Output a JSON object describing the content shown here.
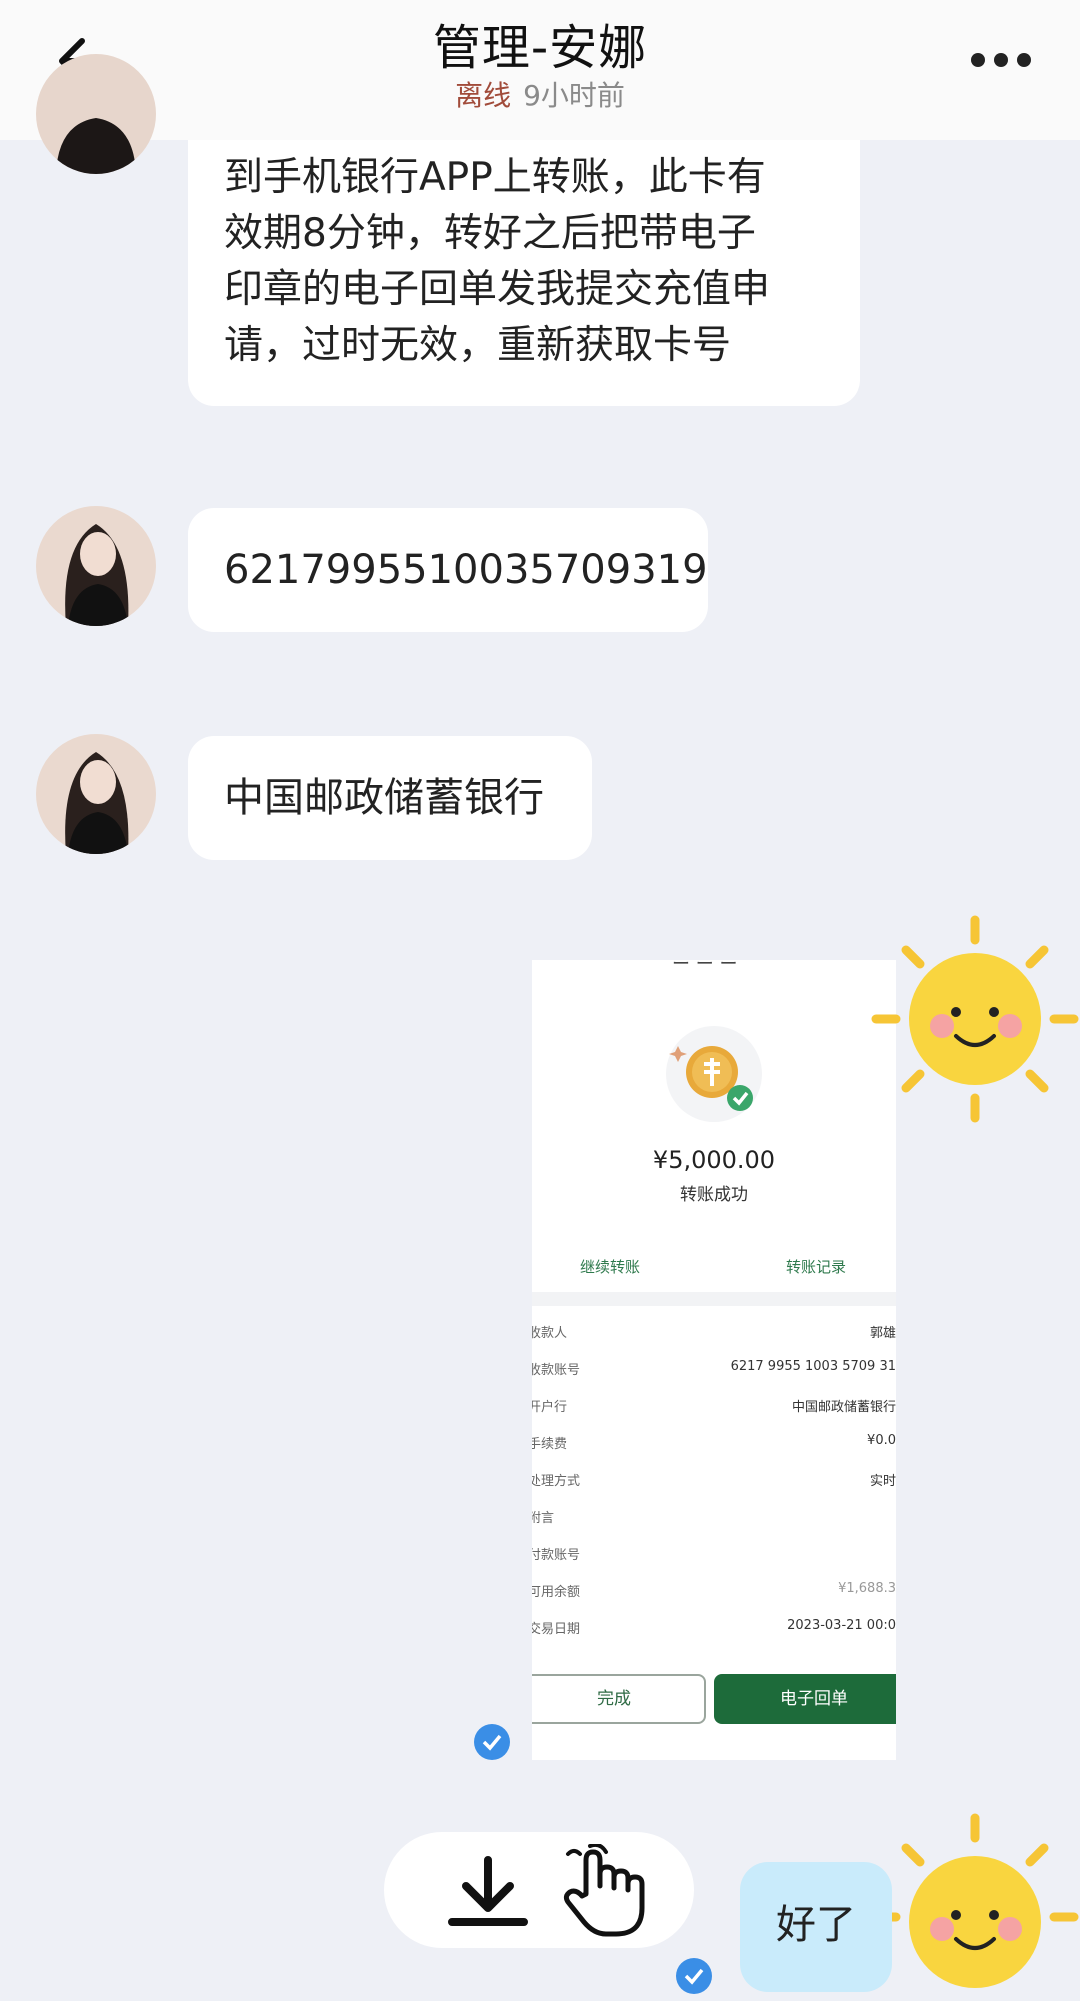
{
  "header": {
    "title": "管理-安娜",
    "status": "离线",
    "last_seen": "9小时前"
  },
  "messages": {
    "m1_lines": [
      "到手机银行APP上转账，此卡有",
      "效期8分钟，转好之后把带电子",
      "印章的电子回单发我提交充值申",
      "请，过时无效，重新获取卡号"
    ],
    "m2": "6217995510035709319",
    "m3": "中国邮政储蓄银行",
    "sent": "好了"
  },
  "receipt": {
    "amount": "¥5,000.00",
    "status": "转账成功",
    "continue_label": "继续转账",
    "records_label": "转账记录",
    "rows": [
      {
        "label": "收款人",
        "value": "郭雄"
      },
      {
        "label": "收款账号",
        "value": "6217 9955 1003 5709 31"
      },
      {
        "label": "开户行",
        "value": "中国邮政储蓄银行"
      },
      {
        "label": "手续费",
        "value": "¥0.0"
      },
      {
        "label": "处理方式",
        "value": "实时"
      },
      {
        "label": "附言",
        "value": ""
      },
      {
        "label": "付款账号",
        "value": ""
      },
      {
        "label": "可用余额",
        "value": "¥1,688.3"
      },
      {
        "label": "交易日期",
        "value": "2023-03-21 00:0"
      }
    ],
    "done_label": "完成",
    "e_receipt_label": "电子回单"
  },
  "colors": {
    "offline": "#a14b3a",
    "sent_bubble": "#c9ebfb",
    "receipt_green": "#1d6b3a",
    "check_blue": "#3a8ee6"
  },
  "icons": [
    "back-arrow-icon",
    "more-dots-icon",
    "download-icon",
    "tap-hand-icon",
    "sun-sticker-icon",
    "check-icon",
    "coin-icon"
  ]
}
